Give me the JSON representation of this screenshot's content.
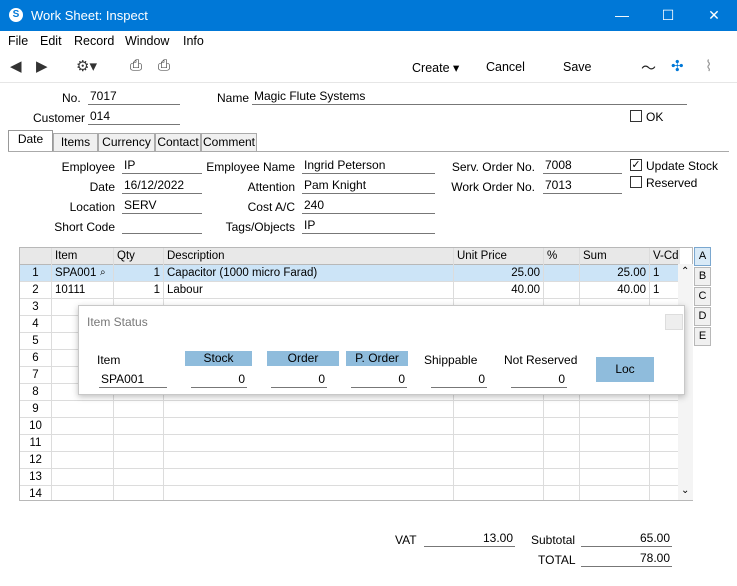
{
  "window": {
    "title": "Work Sheet: Inspect",
    "minimize": "—",
    "maximize": "☐",
    "close": "✕"
  },
  "menu": [
    "File",
    "Edit",
    "Record",
    "Window",
    "Info"
  ],
  "toolbar": {
    "create": "Create",
    "cancel": "Cancel",
    "save": "Save"
  },
  "header": {
    "no_label": "No.",
    "no": "7017",
    "name_label": "Name",
    "name": "Magic Flute Systems",
    "customer_label": "Customer",
    "customer": "014",
    "ok_label": "OK"
  },
  "tabs": [
    "Date",
    "Items",
    "Currency",
    "Contact",
    "Comment"
  ],
  "date_tab": {
    "employee_label": "Employee",
    "employee": "IP",
    "date_label": "Date",
    "date": "16/12/2022",
    "location_label": "Location",
    "location": "SERV",
    "short_code_label": "Short Code",
    "short_code": "",
    "employee_name_label": "Employee Name",
    "employee_name": "Ingrid Peterson",
    "attention_label": "Attention",
    "attention": "Pam Knight",
    "cost_ac_label": "Cost A/C",
    "cost_ac": "240",
    "tags_label": "Tags/Objects",
    "tags": "IP",
    "serv_order_label": "Serv. Order No.",
    "serv_order": "7008",
    "work_order_label": "Work Order No.",
    "work_order": "7013",
    "update_stock_label": "Update Stock",
    "reserved_label": "Reserved"
  },
  "grid": {
    "columns": [
      "Item",
      "Qty",
      "Description",
      "Unit Price",
      "%",
      "Sum",
      "V-Cd"
    ],
    "rows": [
      {
        "num": "1",
        "item": "SPA001",
        "qty": "1",
        "desc": "Capacitor (1000 micro Farad)",
        "price": "25.00",
        "pct": "",
        "sum": "25.00",
        "vcd": "1"
      },
      {
        "num": "2",
        "item": "10111",
        "qty": "1",
        "desc": "Labour",
        "price": "40.00",
        "pct": "",
        "sum": "40.00",
        "vcd": "1"
      },
      {
        "num": "3"
      },
      {
        "num": "4"
      },
      {
        "num": "5"
      },
      {
        "num": "6"
      },
      {
        "num": "7"
      },
      {
        "num": "8"
      },
      {
        "num": "9"
      },
      {
        "num": "10"
      },
      {
        "num": "11"
      },
      {
        "num": "12"
      },
      {
        "num": "13"
      },
      {
        "num": "14"
      }
    ],
    "letters": [
      "A",
      "B",
      "C",
      "D",
      "E"
    ]
  },
  "item_status": {
    "title": "Item Status",
    "item_label": "Item",
    "item": "SPA001",
    "stock_label": "Stock",
    "stock": "0",
    "order_label": "Order",
    "order": "0",
    "porder_label": "P. Order",
    "porder": "0",
    "shippable_label": "Shippable",
    "shippable": "0",
    "not_reserved_label": "Not Reserved",
    "not_reserved": "0",
    "loc_label": "Loc"
  },
  "footer": {
    "vat_label": "VAT",
    "vat": "13.00",
    "subtotal_label": "Subtotal",
    "subtotal": "65.00",
    "total_label": "TOTAL",
    "total": "78.00"
  }
}
